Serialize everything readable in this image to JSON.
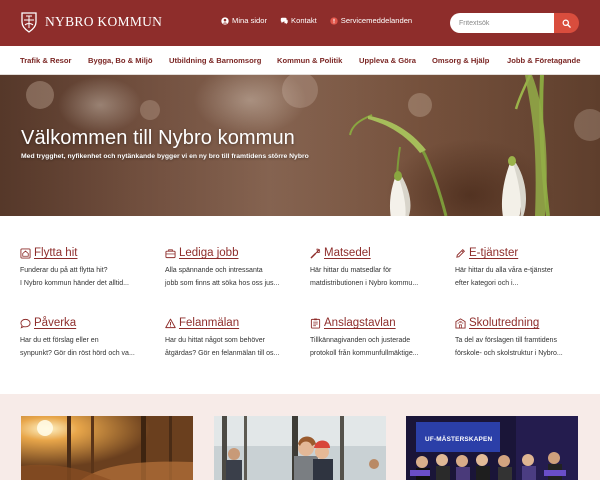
{
  "header": {
    "logo_text": "NYBRO KOMMUN",
    "links": [
      {
        "label": "Mina sidor",
        "icon": "user-icon"
      },
      {
        "label": "Kontakt",
        "icon": "chat-icon"
      },
      {
        "label": "Servicemeddelanden",
        "icon": "alert-icon"
      }
    ],
    "search_placeholder": "Fritextsök"
  },
  "nav": {
    "items": [
      "Trafik & Resor",
      "Bygga, Bo & Miljö",
      "Utbildning & Barnomsorg",
      "Kommun & Politik",
      "Uppleva & Göra",
      "Omsorg & Hjälp",
      "Jobb & Företagande"
    ]
  },
  "hero": {
    "title": "Välkommen till Nybro kommun",
    "subtitle": "Med trygghet, nyfikenhet och nytänkande bygger vi en ny bro till framtidens större Nybro"
  },
  "quick_links": [
    {
      "title": "Flytta hit",
      "icon": "house-icon",
      "line1": "Funderar du på att flytta hit?",
      "line2": "I Nybro kommun händer det alltid..."
    },
    {
      "title": "Lediga jobb",
      "icon": "briefcase-icon",
      "line1": "Alla spännande och intressanta",
      "line2": "jobb som finns att söka hos oss jus..."
    },
    {
      "title": "Matsedel",
      "icon": "utensils-icon",
      "line1": "Här hittar du matsedlar för",
      "line2": "matdistributionen i Nybro kommu..."
    },
    {
      "title": "E-tjänster",
      "icon": "pencil-icon",
      "line1": "Här hittar du alla våra e-tjänster",
      "line2": "efter kategori och i..."
    },
    {
      "title": "Påverka",
      "icon": "comment-icon",
      "line1": "Har du ett förslag eller en",
      "line2": "synpunkt? Gör din röst hörd och va..."
    },
    {
      "title": "Felanmälan",
      "icon": "warning-icon",
      "line1": "Har du hittat något som behöver",
      "line2": "åtgärdas? Gör en felanmälan till os..."
    },
    {
      "title": "Anslagstavlan",
      "icon": "bulletin-icon",
      "line1": "Tillkännagivanden och justerade",
      "line2": "protokoll från kommunfullmäktige..."
    },
    {
      "title": "Skolutredning",
      "icon": "school-icon",
      "line1": "Ta del av förslagen till framtidens",
      "line2": "förskole- och skolstruktur i Nybro..."
    }
  ],
  "news": {
    "image3_banner": "UF-MÄSTERSKAPEN"
  }
}
